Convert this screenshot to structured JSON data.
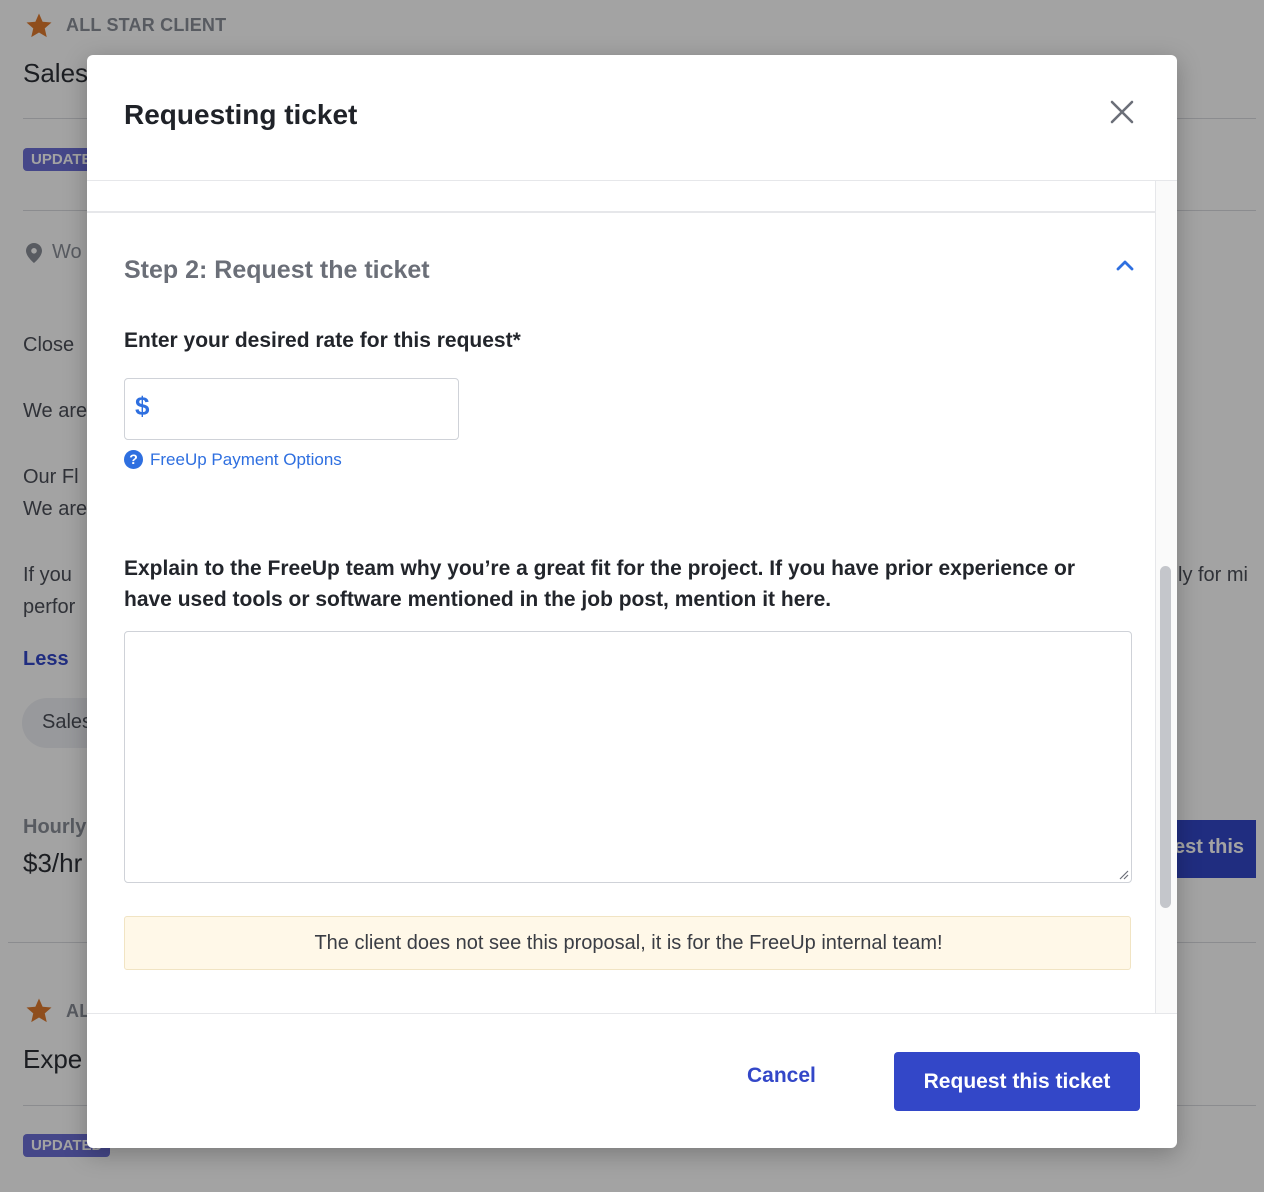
{
  "background": {
    "client_badge": "ALL STAR CLIENT",
    "job_title": "Sales",
    "updated_badge": "UPDATED",
    "location": "Wo",
    "paragraphs": [
      "Close",
      "We are",
      "Our Fl",
      "We are",
      "If you",
      "perfor"
    ],
    "apply_text": "ly for mi",
    "less_link": "Less",
    "skill_pill": "Sales",
    "hourly_label": "Hourly",
    "hourly_value": "$3/hr",
    "request_button_partial": "est this",
    "next_job": {
      "client_badge": "AL",
      "job_title": "Expe",
      "updated_badge": "UPDATED"
    }
  },
  "modal": {
    "title": "Requesting ticket",
    "step_title": "Step 2: Request the ticket",
    "rate_label": "Enter your desired rate for this request*",
    "currency_symbol": "$",
    "rate_value": "",
    "help_icon_glyph": "?",
    "help_link": "FreeUp Payment Options",
    "explain_label": "Explain to the FreeUp team why you’re a great fit for the project. If you have prior experience or have used tools or software mentioned in the job post, mention it here.",
    "explain_value": "",
    "notice": "The client does not see this proposal, it is for the FreeUp internal team!",
    "cancel_label": "Cancel",
    "submit_label": "Request this ticket"
  },
  "colors": {
    "accent": "#3347c8",
    "link": "#2e6fe0",
    "star": "#e07b2e",
    "notice_bg": "#fff8e8"
  },
  "icons": [
    "star-icon",
    "location-pin-icon",
    "close-icon",
    "chevron-up-icon",
    "help-icon",
    "resize-grip-icon"
  ]
}
